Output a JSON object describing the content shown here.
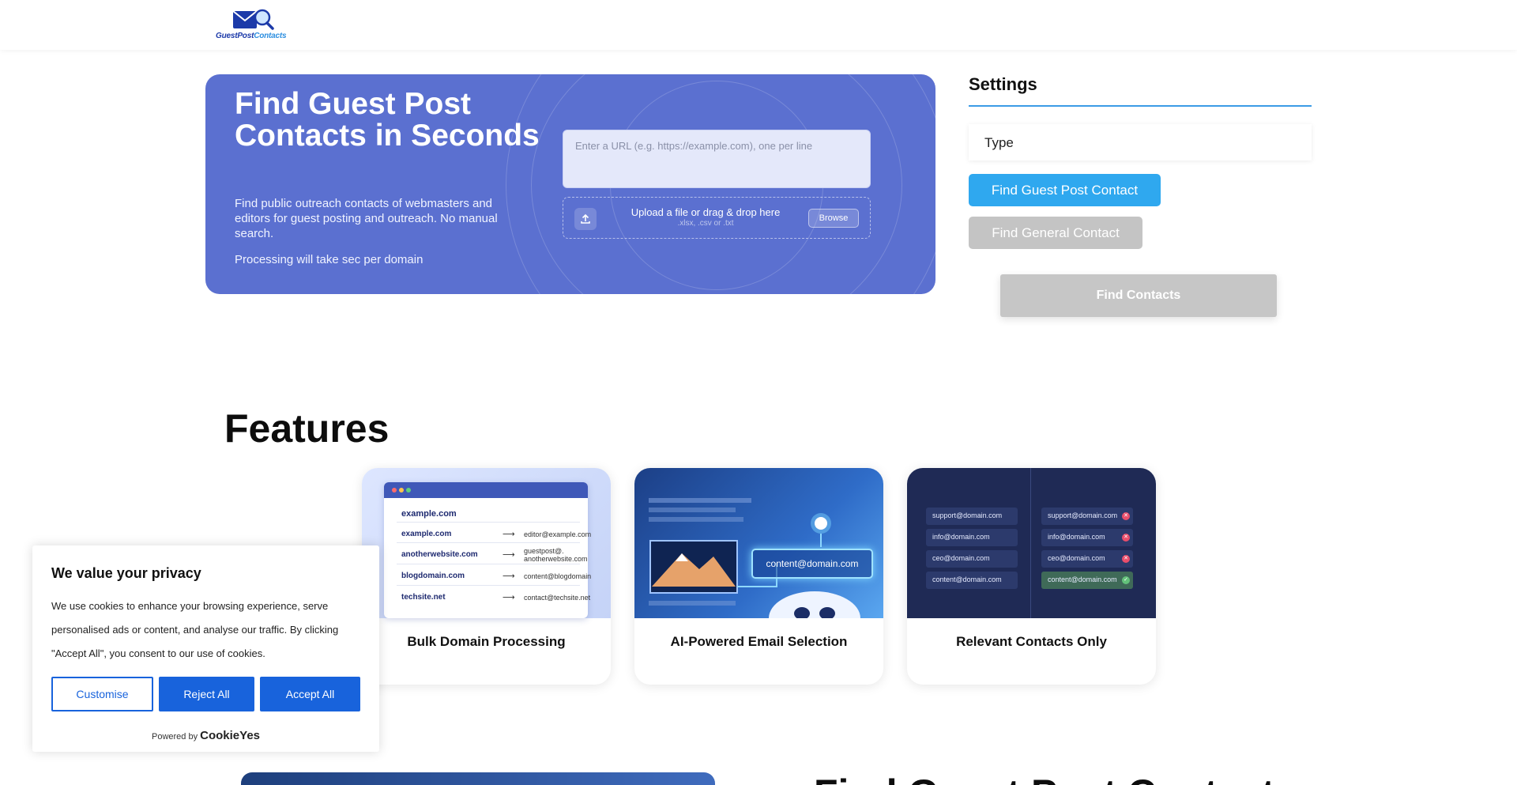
{
  "header": {
    "logo_text_a": "GuestPost",
    "logo_text_b": "Contacts"
  },
  "hero": {
    "title": "Find Guest Post Contacts in Seconds",
    "subtitle": "Find public outreach contacts of webmasters and editors for guest posting and outreach. No manual search.",
    "note": "Processing will take sec per domain",
    "url_placeholder": "Enter a URL (e.g. https://example.com), one per line",
    "upload_text": "Upload a file or drag & drop here",
    "upload_hint": ".xlsx, .csv or .txt",
    "browse_label": "Browse"
  },
  "settings": {
    "title": "Settings",
    "type_label": "Type",
    "guest_button": "Find Guest Post Contact",
    "general_button": "Find General Contact",
    "find_button": "Find Contacts"
  },
  "features": {
    "title": "Features",
    "cards": [
      {
        "label": "Bulk Domain Processing",
        "header_domain": "example.com",
        "rows": [
          {
            "domain": "example.com",
            "email": "editor@example.com"
          },
          {
            "domain": "anotherwebsite.com",
            "email": "guestpost@. anotherwebsite.com"
          },
          {
            "domain": "blogdomain.com",
            "email": "content@blogdomain"
          },
          {
            "domain": "techsite.net",
            "email": "contact@techsite.net"
          }
        ]
      },
      {
        "label": "AI-Powered Email Selection",
        "email": "content@domain.com"
      },
      {
        "label": "Relevant Contacts Only",
        "left_emails": [
          "support@domain.com",
          "info@domain.com",
          "ceo@domain.com",
          "content@domain.com"
        ],
        "right_emails": [
          "support@domain.com",
          "info@domain.com",
          "ceo@domain.com",
          "content@domain.com"
        ]
      }
    ]
  },
  "cookie": {
    "title": "We value your privacy",
    "text": "We use cookies to enhance your browsing experience, serve personalised ads or content, and analyse our traffic. By clicking \"Accept All\", you consent to our use of cookies.",
    "customise": "Customise",
    "reject": "Reject All",
    "accept": "Accept All",
    "powered_by": "Powered by",
    "brand": "CookieYes"
  },
  "bottom": {
    "title": "Find Guest Post Contacts"
  },
  "colors": {
    "hero_bg": "#5b70d0",
    "accent_blue": "#2fa8ef",
    "cookie_blue": "#1863dc",
    "disabled_gray": "#c4c4c4"
  }
}
